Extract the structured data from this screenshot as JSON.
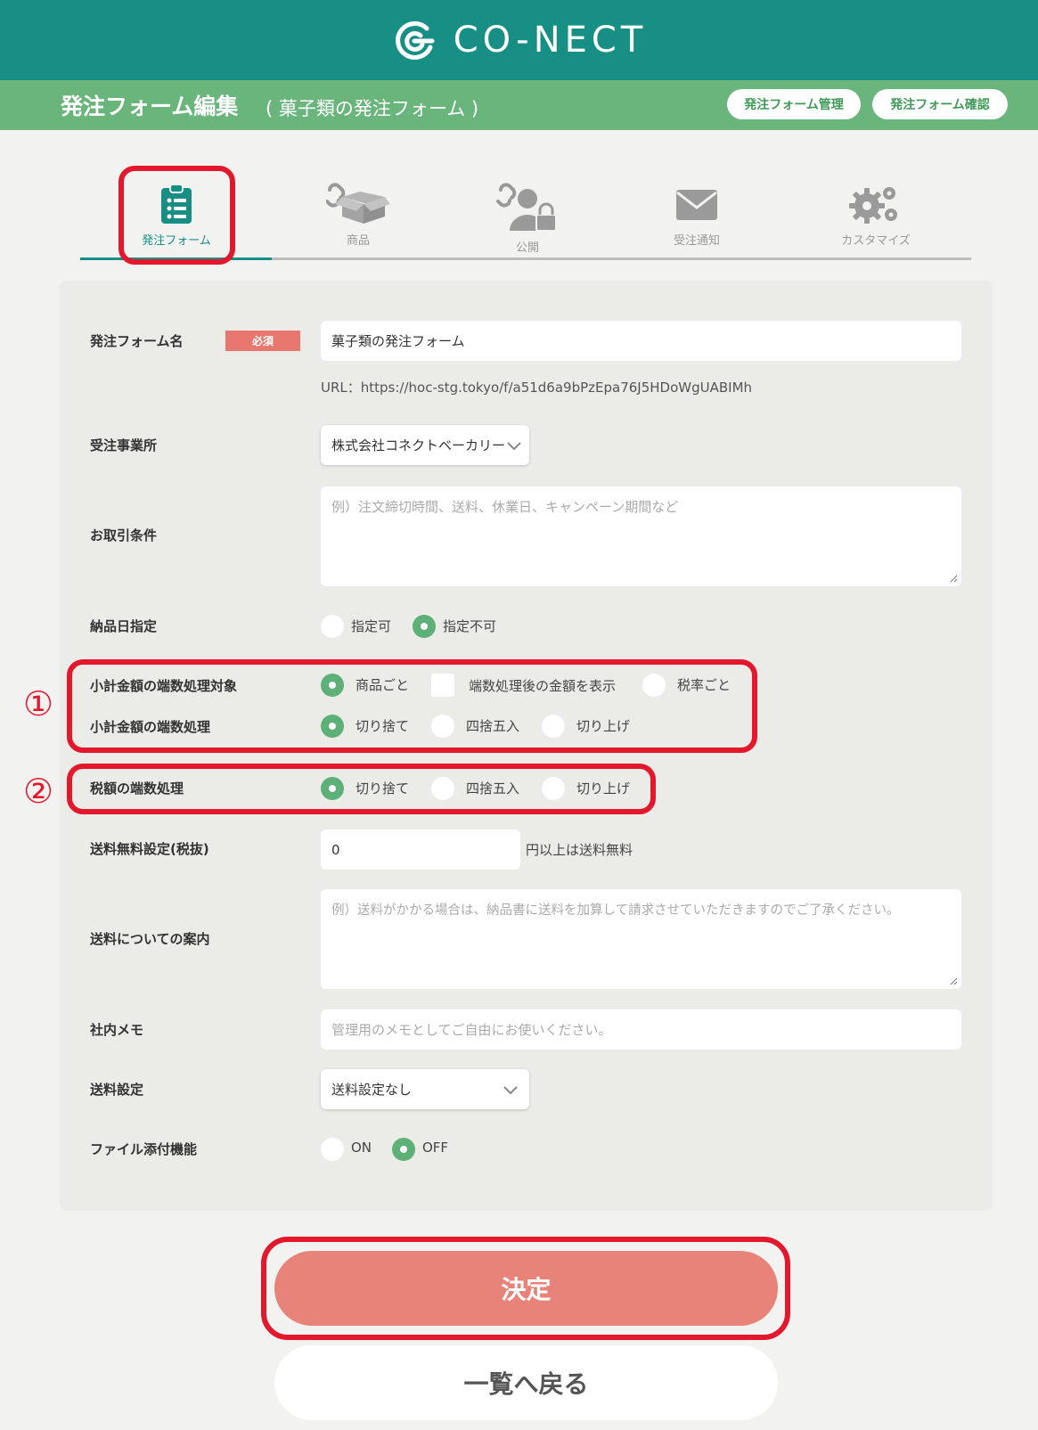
{
  "header": {
    "brand": "CO-NECT",
    "page_title": "発注フォーム編集",
    "page_subtitle": "( 菓子類の発注フォーム )",
    "manage_button": "発注フォーム管理",
    "confirm_button": "発注フォーム確認"
  },
  "tabs": [
    {
      "label": "発注フォーム",
      "icon": "clipboard-list-icon"
    },
    {
      "label": "商品",
      "icon": "link-box-icon"
    },
    {
      "label": "公開",
      "icon": "link-user-lock-icon"
    },
    {
      "label": "受注通知",
      "icon": "envelope-icon"
    },
    {
      "label": "カスタマイズ",
      "icon": "gears-icon"
    }
  ],
  "annotations": {
    "marker_1": "①",
    "marker_2": "②"
  },
  "form": {
    "name": {
      "label": "発注フォーム名",
      "required_badge": "必須",
      "value": "菓子類の発注フォーム",
      "url": "URL：https://hoc-stg.tokyo/f/a51d6a9bPzEpa76J5HDoWgUABIMh"
    },
    "office": {
      "label": "受注事業所",
      "value": "株式会社コネクトベーカリー"
    },
    "conditions": {
      "label": "お取引条件",
      "placeholder": "例）注文締切時間、送料、休業日、キャンペーン期間など"
    },
    "delivery_date": {
      "label": "納品日指定",
      "options": [
        "指定可",
        "指定不可"
      ],
      "selected": "指定不可"
    },
    "subtotal_target": {
      "label": "小計金額の端数処理対象",
      "options": [
        "商品ごと",
        "端数処理後の金額を表示",
        "税率ごと"
      ],
      "selected": "商品ごと"
    },
    "subtotal_rounding": {
      "label": "小計金額の端数処理",
      "options": [
        "切り捨て",
        "四捨五入",
        "切り上げ"
      ],
      "selected": "切り捨て"
    },
    "tax_rounding": {
      "label": "税額の端数処理",
      "options": [
        "切り捨て",
        "四捨五入",
        "切り上げ"
      ],
      "selected": "切り捨て"
    },
    "free_shipping": {
      "label": "送料無料設定(税抜)",
      "value": "0",
      "suffix": "円以上は送料無料"
    },
    "shipping_note": {
      "label": "送料についての案内",
      "placeholder": "例）送料がかかる場合は、納品書に送料を加算して請求させていただきますのでご了承ください。"
    },
    "memo": {
      "label": "社内メモ",
      "placeholder": "管理用のメモとしてご自由にお使いください。"
    },
    "shipping_setting": {
      "label": "送料設定",
      "value": "送料設定なし"
    },
    "file_attach": {
      "label": "ファイル添付機能",
      "options": [
        "ON",
        "OFF"
      ],
      "selected": "OFF"
    }
  },
  "actions": {
    "submit": "決定",
    "back": "一覧へ戻る"
  },
  "colors": {
    "header_teal": "#178f84",
    "subheader_green": "#6ab57c",
    "radio_green": "#5db078",
    "submit_salmon": "#e8837a",
    "highlight_red": "#e3182d"
  }
}
